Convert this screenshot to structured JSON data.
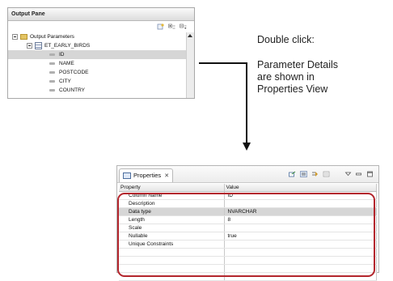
{
  "output_pane": {
    "title": "Output Pane",
    "tree": {
      "root": "Output Parameters",
      "table": "ET_EARLY_BIRDS",
      "columns": [
        "ID",
        "NAME",
        "POSTCODE",
        "CITY",
        "COUNTRY"
      ],
      "selected": "ID"
    }
  },
  "annotation": {
    "line1": "Double click:",
    "line2": "Parameter Details",
    "line3": "are shown in",
    "line4": "Properties View"
  },
  "properties_view": {
    "tab_label": "Properties",
    "tab_close": "✕",
    "headers": [
      "Property",
      "Value"
    ],
    "rows": [
      {
        "property": "Column Name",
        "value": "ID"
      },
      {
        "property": "Description",
        "value": ""
      },
      {
        "property": "Data type",
        "value": "NVARCHAR"
      },
      {
        "property": "Length",
        "value": "8"
      },
      {
        "property": "Scale",
        "value": ""
      },
      {
        "property": "Nullable",
        "value": "true"
      },
      {
        "property": "Unique Constraints",
        "value": ""
      }
    ],
    "selected_row": "Data type"
  },
  "colors": {
    "highlight": "#b3262d",
    "selection": "#d6d6d6",
    "arrow": "#111111"
  }
}
